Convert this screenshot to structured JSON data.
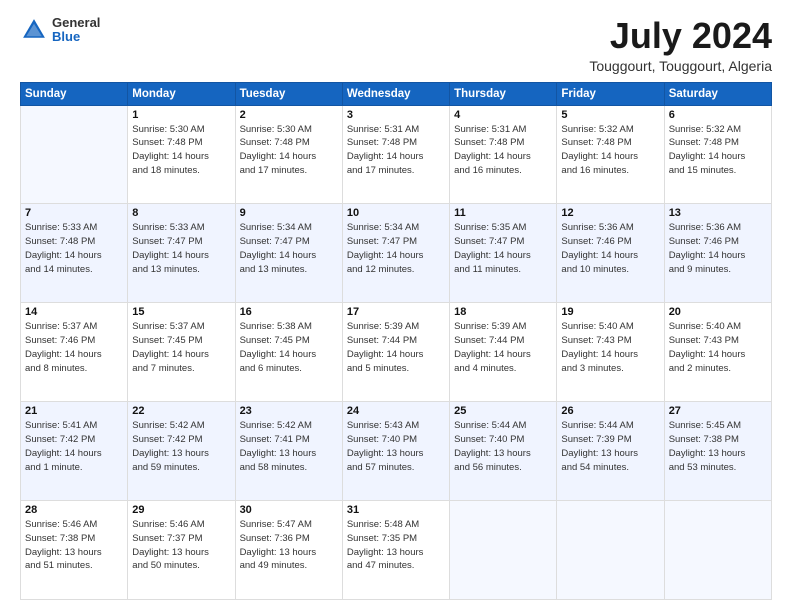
{
  "header": {
    "logo": {
      "line1": "General",
      "line2": "Blue"
    },
    "month": "July 2024",
    "location": "Touggourt, Touggourt, Algeria"
  },
  "weekdays": [
    "Sunday",
    "Monday",
    "Tuesday",
    "Wednesday",
    "Thursday",
    "Friday",
    "Saturday"
  ],
  "weeks": [
    [
      {
        "day": "",
        "info": ""
      },
      {
        "day": "1",
        "info": "Sunrise: 5:30 AM\nSunset: 7:48 PM\nDaylight: 14 hours\nand 18 minutes."
      },
      {
        "day": "2",
        "info": "Sunrise: 5:30 AM\nSunset: 7:48 PM\nDaylight: 14 hours\nand 17 minutes."
      },
      {
        "day": "3",
        "info": "Sunrise: 5:31 AM\nSunset: 7:48 PM\nDaylight: 14 hours\nand 17 minutes."
      },
      {
        "day": "4",
        "info": "Sunrise: 5:31 AM\nSunset: 7:48 PM\nDaylight: 14 hours\nand 16 minutes."
      },
      {
        "day": "5",
        "info": "Sunrise: 5:32 AM\nSunset: 7:48 PM\nDaylight: 14 hours\nand 16 minutes."
      },
      {
        "day": "6",
        "info": "Sunrise: 5:32 AM\nSunset: 7:48 PM\nDaylight: 14 hours\nand 15 minutes."
      }
    ],
    [
      {
        "day": "7",
        "info": "Sunrise: 5:33 AM\nSunset: 7:48 PM\nDaylight: 14 hours\nand 14 minutes."
      },
      {
        "day": "8",
        "info": "Sunrise: 5:33 AM\nSunset: 7:47 PM\nDaylight: 14 hours\nand 13 minutes."
      },
      {
        "day": "9",
        "info": "Sunrise: 5:34 AM\nSunset: 7:47 PM\nDaylight: 14 hours\nand 13 minutes."
      },
      {
        "day": "10",
        "info": "Sunrise: 5:34 AM\nSunset: 7:47 PM\nDaylight: 14 hours\nand 12 minutes."
      },
      {
        "day": "11",
        "info": "Sunrise: 5:35 AM\nSunset: 7:47 PM\nDaylight: 14 hours\nand 11 minutes."
      },
      {
        "day": "12",
        "info": "Sunrise: 5:36 AM\nSunset: 7:46 PM\nDaylight: 14 hours\nand 10 minutes."
      },
      {
        "day": "13",
        "info": "Sunrise: 5:36 AM\nSunset: 7:46 PM\nDaylight: 14 hours\nand 9 minutes."
      }
    ],
    [
      {
        "day": "14",
        "info": "Sunrise: 5:37 AM\nSunset: 7:46 PM\nDaylight: 14 hours\nand 8 minutes."
      },
      {
        "day": "15",
        "info": "Sunrise: 5:37 AM\nSunset: 7:45 PM\nDaylight: 14 hours\nand 7 minutes."
      },
      {
        "day": "16",
        "info": "Sunrise: 5:38 AM\nSunset: 7:45 PM\nDaylight: 14 hours\nand 6 minutes."
      },
      {
        "day": "17",
        "info": "Sunrise: 5:39 AM\nSunset: 7:44 PM\nDaylight: 14 hours\nand 5 minutes."
      },
      {
        "day": "18",
        "info": "Sunrise: 5:39 AM\nSunset: 7:44 PM\nDaylight: 14 hours\nand 4 minutes."
      },
      {
        "day": "19",
        "info": "Sunrise: 5:40 AM\nSunset: 7:43 PM\nDaylight: 14 hours\nand 3 minutes."
      },
      {
        "day": "20",
        "info": "Sunrise: 5:40 AM\nSunset: 7:43 PM\nDaylight: 14 hours\nand 2 minutes."
      }
    ],
    [
      {
        "day": "21",
        "info": "Sunrise: 5:41 AM\nSunset: 7:42 PM\nDaylight: 14 hours\nand 1 minute."
      },
      {
        "day": "22",
        "info": "Sunrise: 5:42 AM\nSunset: 7:42 PM\nDaylight: 13 hours\nand 59 minutes."
      },
      {
        "day": "23",
        "info": "Sunrise: 5:42 AM\nSunset: 7:41 PM\nDaylight: 13 hours\nand 58 minutes."
      },
      {
        "day": "24",
        "info": "Sunrise: 5:43 AM\nSunset: 7:40 PM\nDaylight: 13 hours\nand 57 minutes."
      },
      {
        "day": "25",
        "info": "Sunrise: 5:44 AM\nSunset: 7:40 PM\nDaylight: 13 hours\nand 56 minutes."
      },
      {
        "day": "26",
        "info": "Sunrise: 5:44 AM\nSunset: 7:39 PM\nDaylight: 13 hours\nand 54 minutes."
      },
      {
        "day": "27",
        "info": "Sunrise: 5:45 AM\nSunset: 7:38 PM\nDaylight: 13 hours\nand 53 minutes."
      }
    ],
    [
      {
        "day": "28",
        "info": "Sunrise: 5:46 AM\nSunset: 7:38 PM\nDaylight: 13 hours\nand 51 minutes."
      },
      {
        "day": "29",
        "info": "Sunrise: 5:46 AM\nSunset: 7:37 PM\nDaylight: 13 hours\nand 50 minutes."
      },
      {
        "day": "30",
        "info": "Sunrise: 5:47 AM\nSunset: 7:36 PM\nDaylight: 13 hours\nand 49 minutes."
      },
      {
        "day": "31",
        "info": "Sunrise: 5:48 AM\nSunset: 7:35 PM\nDaylight: 13 hours\nand 47 minutes."
      },
      {
        "day": "",
        "info": ""
      },
      {
        "day": "",
        "info": ""
      },
      {
        "day": "",
        "info": ""
      }
    ]
  ]
}
